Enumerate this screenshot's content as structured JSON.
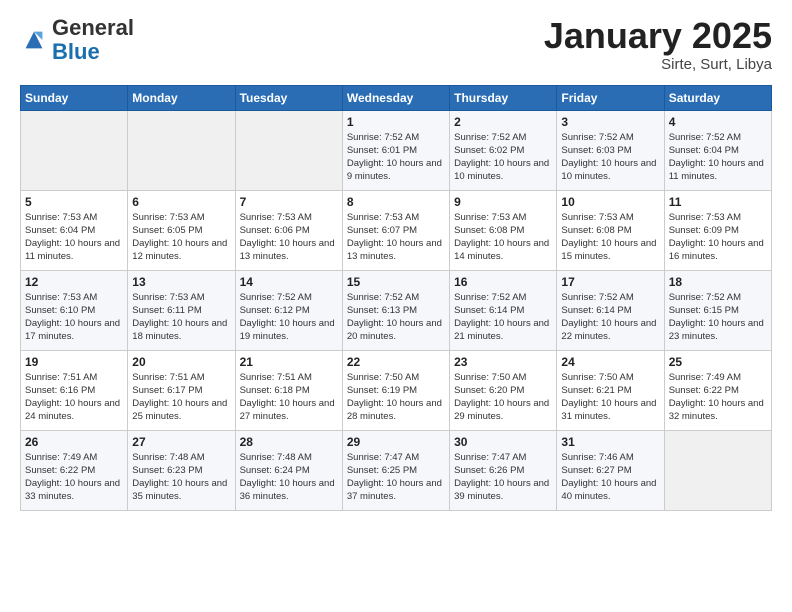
{
  "logo": {
    "general": "General",
    "blue": "Blue"
  },
  "header": {
    "title": "January 2025",
    "subtitle": "Sirte, Surt, Libya"
  },
  "weekdays": [
    "Sunday",
    "Monday",
    "Tuesday",
    "Wednesday",
    "Thursday",
    "Friday",
    "Saturday"
  ],
  "weeks": [
    [
      {
        "day": "",
        "sunrise": "",
        "sunset": "",
        "daylight": ""
      },
      {
        "day": "",
        "sunrise": "",
        "sunset": "",
        "daylight": ""
      },
      {
        "day": "",
        "sunrise": "",
        "sunset": "",
        "daylight": ""
      },
      {
        "day": "1",
        "sunrise": "Sunrise: 7:52 AM",
        "sunset": "Sunset: 6:01 PM",
        "daylight": "Daylight: 10 hours and 9 minutes."
      },
      {
        "day": "2",
        "sunrise": "Sunrise: 7:52 AM",
        "sunset": "Sunset: 6:02 PM",
        "daylight": "Daylight: 10 hours and 10 minutes."
      },
      {
        "day": "3",
        "sunrise": "Sunrise: 7:52 AM",
        "sunset": "Sunset: 6:03 PM",
        "daylight": "Daylight: 10 hours and 10 minutes."
      },
      {
        "day": "4",
        "sunrise": "Sunrise: 7:52 AM",
        "sunset": "Sunset: 6:04 PM",
        "daylight": "Daylight: 10 hours and 11 minutes."
      }
    ],
    [
      {
        "day": "5",
        "sunrise": "Sunrise: 7:53 AM",
        "sunset": "Sunset: 6:04 PM",
        "daylight": "Daylight: 10 hours and 11 minutes."
      },
      {
        "day": "6",
        "sunrise": "Sunrise: 7:53 AM",
        "sunset": "Sunset: 6:05 PM",
        "daylight": "Daylight: 10 hours and 12 minutes."
      },
      {
        "day": "7",
        "sunrise": "Sunrise: 7:53 AM",
        "sunset": "Sunset: 6:06 PM",
        "daylight": "Daylight: 10 hours and 13 minutes."
      },
      {
        "day": "8",
        "sunrise": "Sunrise: 7:53 AM",
        "sunset": "Sunset: 6:07 PM",
        "daylight": "Daylight: 10 hours and 13 minutes."
      },
      {
        "day": "9",
        "sunrise": "Sunrise: 7:53 AM",
        "sunset": "Sunset: 6:08 PM",
        "daylight": "Daylight: 10 hours and 14 minutes."
      },
      {
        "day": "10",
        "sunrise": "Sunrise: 7:53 AM",
        "sunset": "Sunset: 6:08 PM",
        "daylight": "Daylight: 10 hours and 15 minutes."
      },
      {
        "day": "11",
        "sunrise": "Sunrise: 7:53 AM",
        "sunset": "Sunset: 6:09 PM",
        "daylight": "Daylight: 10 hours and 16 minutes."
      }
    ],
    [
      {
        "day": "12",
        "sunrise": "Sunrise: 7:53 AM",
        "sunset": "Sunset: 6:10 PM",
        "daylight": "Daylight: 10 hours and 17 minutes."
      },
      {
        "day": "13",
        "sunrise": "Sunrise: 7:53 AM",
        "sunset": "Sunset: 6:11 PM",
        "daylight": "Daylight: 10 hours and 18 minutes."
      },
      {
        "day": "14",
        "sunrise": "Sunrise: 7:52 AM",
        "sunset": "Sunset: 6:12 PM",
        "daylight": "Daylight: 10 hours and 19 minutes."
      },
      {
        "day": "15",
        "sunrise": "Sunrise: 7:52 AM",
        "sunset": "Sunset: 6:13 PM",
        "daylight": "Daylight: 10 hours and 20 minutes."
      },
      {
        "day": "16",
        "sunrise": "Sunrise: 7:52 AM",
        "sunset": "Sunset: 6:14 PM",
        "daylight": "Daylight: 10 hours and 21 minutes."
      },
      {
        "day": "17",
        "sunrise": "Sunrise: 7:52 AM",
        "sunset": "Sunset: 6:14 PM",
        "daylight": "Daylight: 10 hours and 22 minutes."
      },
      {
        "day": "18",
        "sunrise": "Sunrise: 7:52 AM",
        "sunset": "Sunset: 6:15 PM",
        "daylight": "Daylight: 10 hours and 23 minutes."
      }
    ],
    [
      {
        "day": "19",
        "sunrise": "Sunrise: 7:51 AM",
        "sunset": "Sunset: 6:16 PM",
        "daylight": "Daylight: 10 hours and 24 minutes."
      },
      {
        "day": "20",
        "sunrise": "Sunrise: 7:51 AM",
        "sunset": "Sunset: 6:17 PM",
        "daylight": "Daylight: 10 hours and 25 minutes."
      },
      {
        "day": "21",
        "sunrise": "Sunrise: 7:51 AM",
        "sunset": "Sunset: 6:18 PM",
        "daylight": "Daylight: 10 hours and 27 minutes."
      },
      {
        "day": "22",
        "sunrise": "Sunrise: 7:50 AM",
        "sunset": "Sunset: 6:19 PM",
        "daylight": "Daylight: 10 hours and 28 minutes."
      },
      {
        "day": "23",
        "sunrise": "Sunrise: 7:50 AM",
        "sunset": "Sunset: 6:20 PM",
        "daylight": "Daylight: 10 hours and 29 minutes."
      },
      {
        "day": "24",
        "sunrise": "Sunrise: 7:50 AM",
        "sunset": "Sunset: 6:21 PM",
        "daylight": "Daylight: 10 hours and 31 minutes."
      },
      {
        "day": "25",
        "sunrise": "Sunrise: 7:49 AM",
        "sunset": "Sunset: 6:22 PM",
        "daylight": "Daylight: 10 hours and 32 minutes."
      }
    ],
    [
      {
        "day": "26",
        "sunrise": "Sunrise: 7:49 AM",
        "sunset": "Sunset: 6:22 PM",
        "daylight": "Daylight: 10 hours and 33 minutes."
      },
      {
        "day": "27",
        "sunrise": "Sunrise: 7:48 AM",
        "sunset": "Sunset: 6:23 PM",
        "daylight": "Daylight: 10 hours and 35 minutes."
      },
      {
        "day": "28",
        "sunrise": "Sunrise: 7:48 AM",
        "sunset": "Sunset: 6:24 PM",
        "daylight": "Daylight: 10 hours and 36 minutes."
      },
      {
        "day": "29",
        "sunrise": "Sunrise: 7:47 AM",
        "sunset": "Sunset: 6:25 PM",
        "daylight": "Daylight: 10 hours and 37 minutes."
      },
      {
        "day": "30",
        "sunrise": "Sunrise: 7:47 AM",
        "sunset": "Sunset: 6:26 PM",
        "daylight": "Daylight: 10 hours and 39 minutes."
      },
      {
        "day": "31",
        "sunrise": "Sunrise: 7:46 AM",
        "sunset": "Sunset: 6:27 PM",
        "daylight": "Daylight: 10 hours and 40 minutes."
      },
      {
        "day": "",
        "sunrise": "",
        "sunset": "",
        "daylight": ""
      }
    ]
  ]
}
